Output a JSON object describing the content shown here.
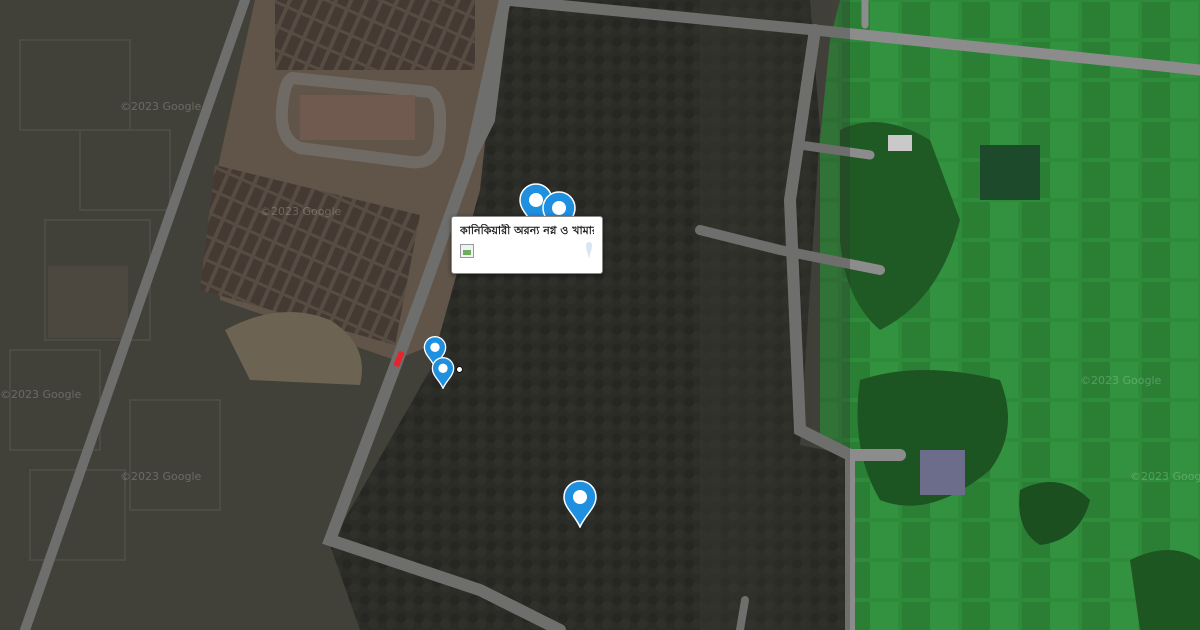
{
  "map": {
    "type": "satellite",
    "watermark_text": "©2023 Google",
    "markers": [
      {
        "name": "map-marker-1",
        "color": "#1f8fe0"
      },
      {
        "name": "map-marker-2",
        "color": "#1f8fe0"
      },
      {
        "name": "map-marker-3",
        "color": "#1f8fe0"
      },
      {
        "name": "map-marker-4",
        "color": "#1f8fe0"
      },
      {
        "name": "map-marker-5",
        "color": "#1f8fe0"
      }
    ]
  },
  "popup": {
    "title": "কানিকিয়ারী অরন্য নগ্ন ও খামার বাড়ি",
    "image_icon": "broken-image-icon"
  },
  "colors": {
    "marker": "#1f8fe0",
    "road": "#8c8c8c",
    "field_green": "#2f8a3a",
    "dim_overlay": "#2f2e29"
  }
}
